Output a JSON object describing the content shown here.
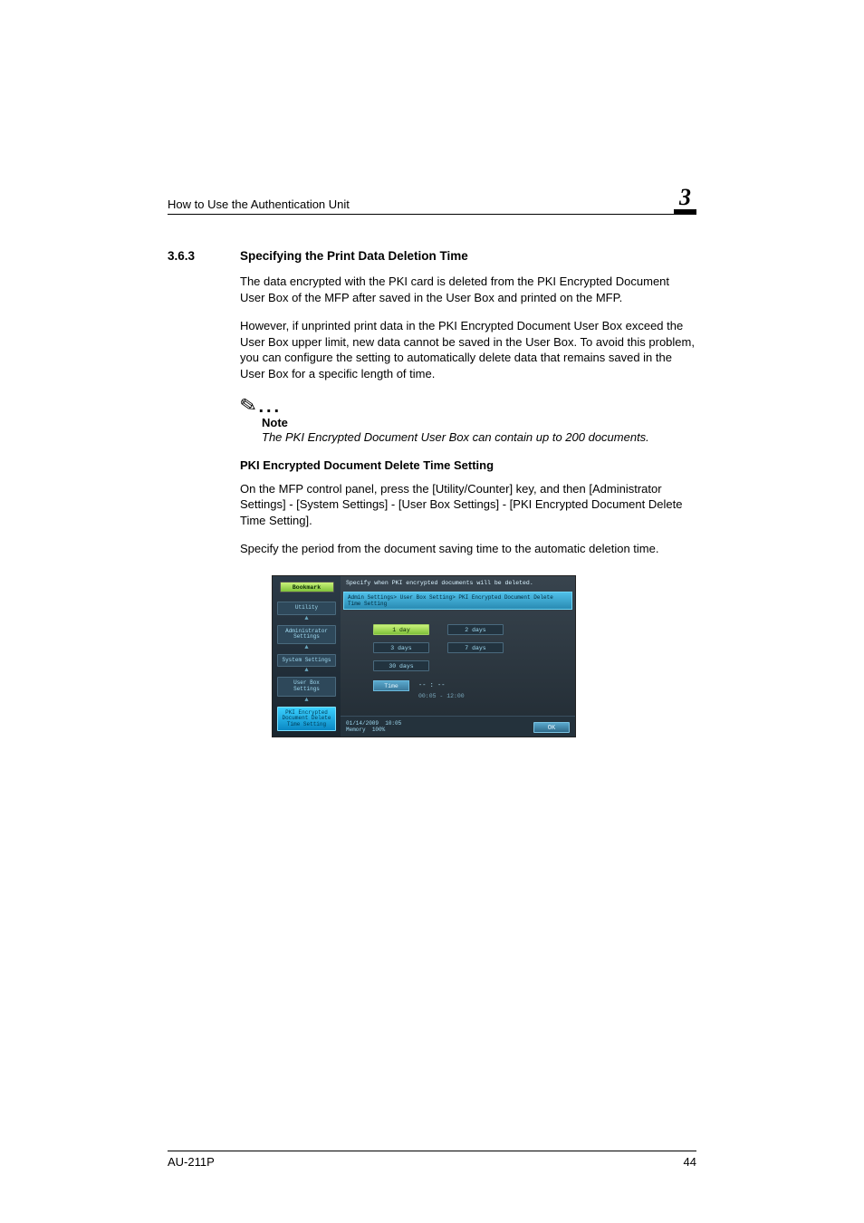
{
  "header": {
    "title": "How to Use the Authentication Unit",
    "chapter": "3"
  },
  "section": {
    "number": "3.6.3",
    "title": "Specifying the Print Data Deletion Time"
  },
  "paragraphs": {
    "p1": "The data encrypted with the PKI card is deleted from the PKI Encrypted Document User Box of the MFP after saved in the User Box and printed on the MFP.",
    "p2": "However, if unprinted print data in the PKI Encrypted Document User Box exceed the User Box upper limit, new data cannot be saved in the User Box. To avoid this problem, you can configure the setting to automatically delete data that remains saved in the User Box for a specific length of time."
  },
  "note": {
    "label": "Note",
    "text": "The PKI Encrypted Document User Box can contain up to 200 documents."
  },
  "subheading": "PKI Encrypted Document Delete Time Setting",
  "paragraphs2": {
    "p3": "On the MFP control panel, press the [Utility/Counter] key, and then [Administrator Settings] - [System Settings] - [User Box Settings] - [PKI Encrypted Document Delete Time Setting].",
    "p4": "Specify the period from the document saving time to the automatic deletion time."
  },
  "screenshot": {
    "bookmark": "Bookmark",
    "nav": {
      "utility": "Utility",
      "admin": "Administrator Settings",
      "system": "System Settings",
      "userbox": "User Box Settings",
      "pki": "PKI Encrypted Document Delete Time Setting"
    },
    "instruction": "Specify when PKI encrypted documents will be deleted.",
    "breadcrumb": "Admin Settings> User Box Setting> PKI Encrypted Document Delete Time Setting",
    "options": {
      "d1": "1 day",
      "d2": "2 days",
      "d3": "3 days",
      "d7": "7 days",
      "d30": "30 days",
      "time_label": "Time",
      "time_value": "-- : --",
      "time_range": "00:05  -  12:00"
    },
    "footer": {
      "date": "01/14/2009",
      "time": "10:05",
      "memory_label": "Memory",
      "memory_value": "100%",
      "ok": "OK"
    }
  },
  "footer": {
    "model": "AU-211P",
    "page": "44"
  }
}
